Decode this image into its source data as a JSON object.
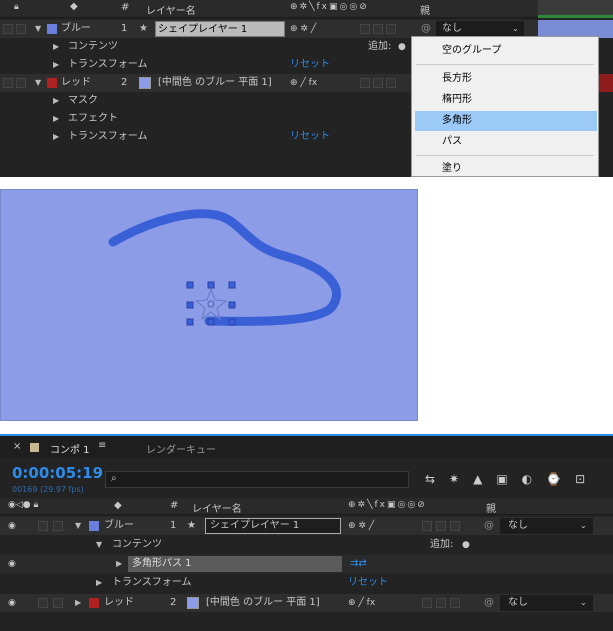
{
  "top": {
    "col_layer_name": "レイヤー名",
    "col_parent": "親",
    "col_num": "#",
    "layer1": {
      "num": "1",
      "label": "ブルー",
      "name": "シェイプレイヤー 1",
      "parent": "なし",
      "color": "#4a78c8"
    },
    "contents": "コンテンツ",
    "add": "追加:",
    "transform": "トランスフォーム",
    "reset": "リセット",
    "layer2": {
      "num": "2",
      "label": "レッド",
      "name": "[中間色 のブルー 平面 1]",
      "color": "#8e1c1c"
    },
    "mask": "マスク",
    "effect": "エフェクト",
    "transform2": "トランスフォーム",
    "reset2": "リセット"
  },
  "menu": {
    "items": [
      "空のグループ",
      "長方形",
      "楕円形",
      "多角形",
      "パス",
      "塗り"
    ],
    "selected": "多角形"
  },
  "canvas": {
    "bg": "#8c9ce6",
    "stroke": "#3a60d8"
  },
  "bottom": {
    "close": "×",
    "tab": "コンポ 1",
    "menu_icon": "≡",
    "render": "レンダーキュー",
    "time": "0:00:05:19",
    "fps": "00169 (29.97 fps)",
    "search_placeholder": "",
    "col_layer_name": "レイヤー名",
    "col_parent": "親",
    "col_num": "#",
    "layer1": {
      "num": "1",
      "label": "ブルー",
      "name": "シェイプレイヤー 1",
      "parent": "なし"
    },
    "contents": "コンテンツ",
    "add": "追加:",
    "path": "多角形パス 1",
    "transform": "トランスフォーム",
    "reset": "リセット",
    "layer2": {
      "num": "2",
      "label": "レッド",
      "name": "[中間色 のブルー 平面 1]",
      "parent": "なし"
    }
  }
}
